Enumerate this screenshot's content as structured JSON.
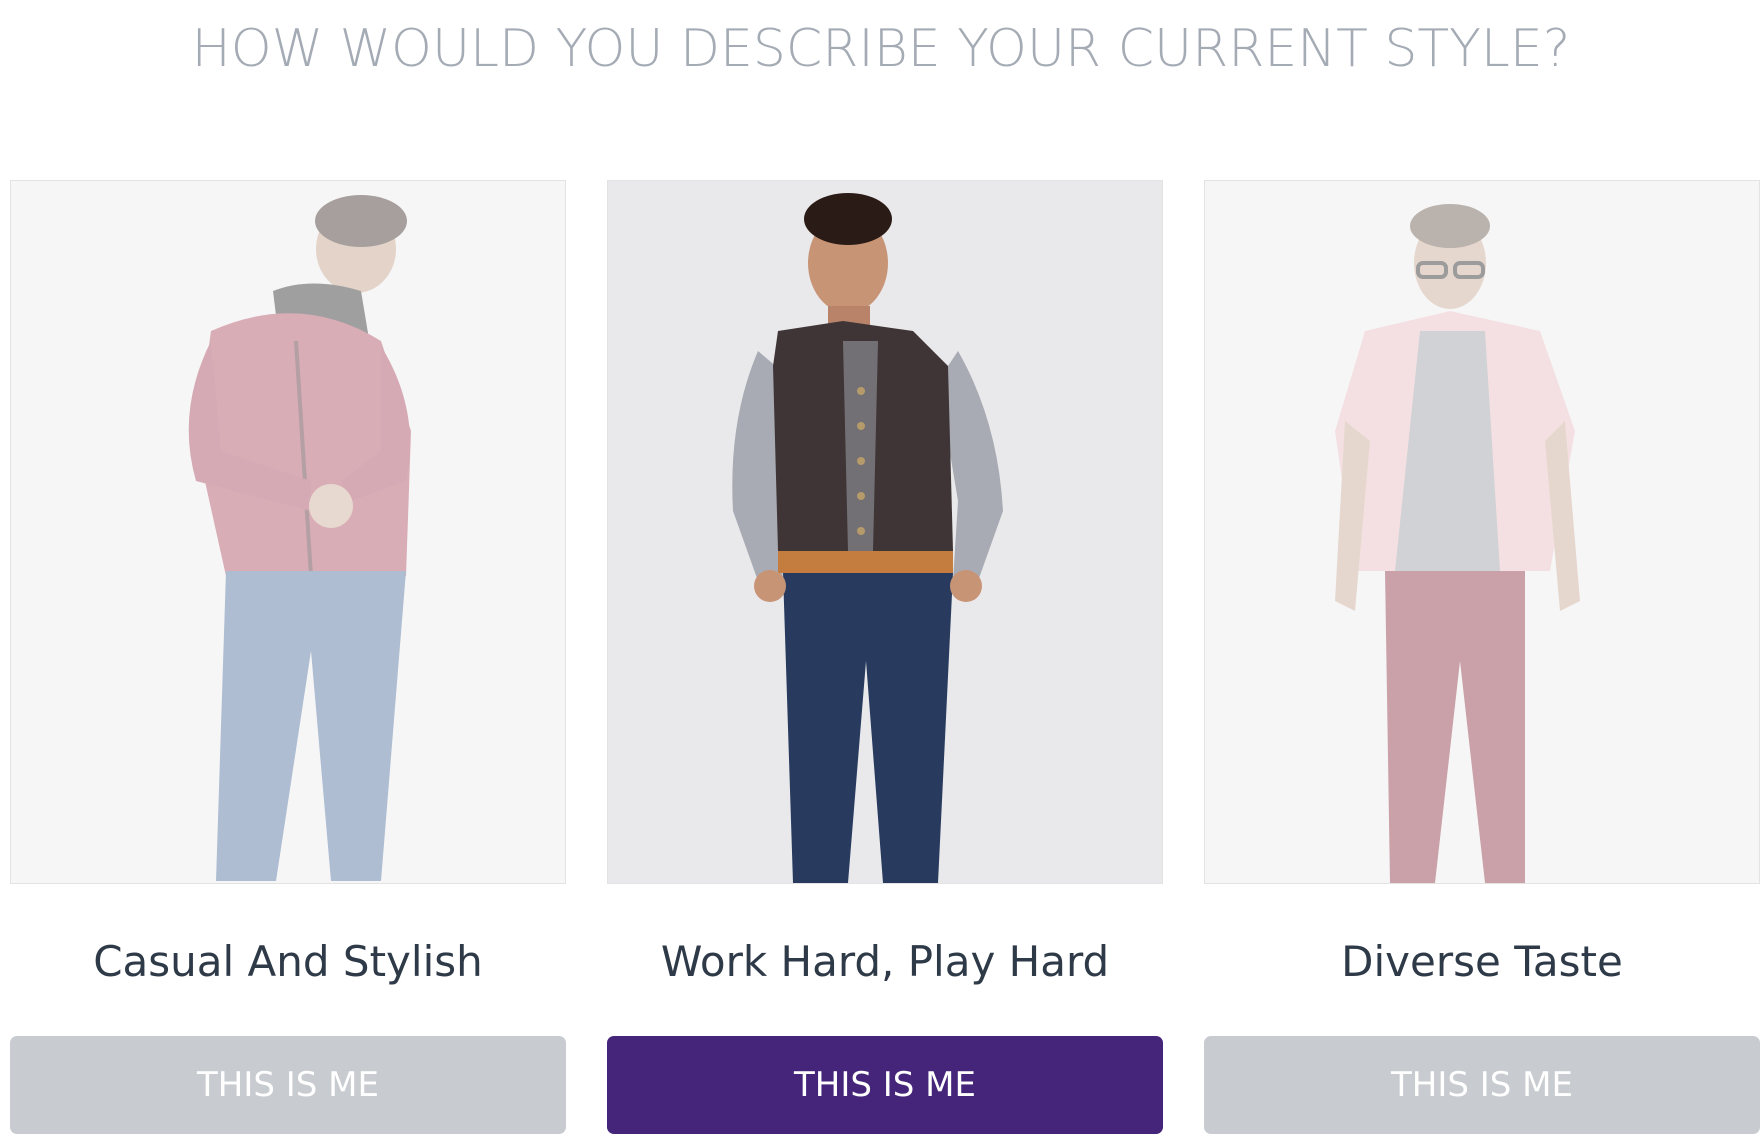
{
  "question": "HOW WOULD YOU DESCRIBE YOUR CURRENT STYLE?",
  "colors": {
    "question_text": "#a4abb4",
    "caption_text": "#2f3a48",
    "button_active": "#45257a",
    "button_inactive": "#c8cbcf",
    "button_text": "#ffffff"
  },
  "options": [
    {
      "caption": "Casual And Stylish",
      "button_label": "THIS IS ME",
      "selected": false,
      "photo": "man-red-hoodie-jeans-photo"
    },
    {
      "caption": "Work Hard, Play Hard",
      "button_label": "THIS IS ME",
      "selected": true,
      "photo": "man-vest-navy-chinos-photo"
    },
    {
      "caption": "Diverse Taste",
      "button_label": "THIS IS ME",
      "selected": false,
      "photo": "man-glasses-pink-shirt-photo"
    }
  ]
}
